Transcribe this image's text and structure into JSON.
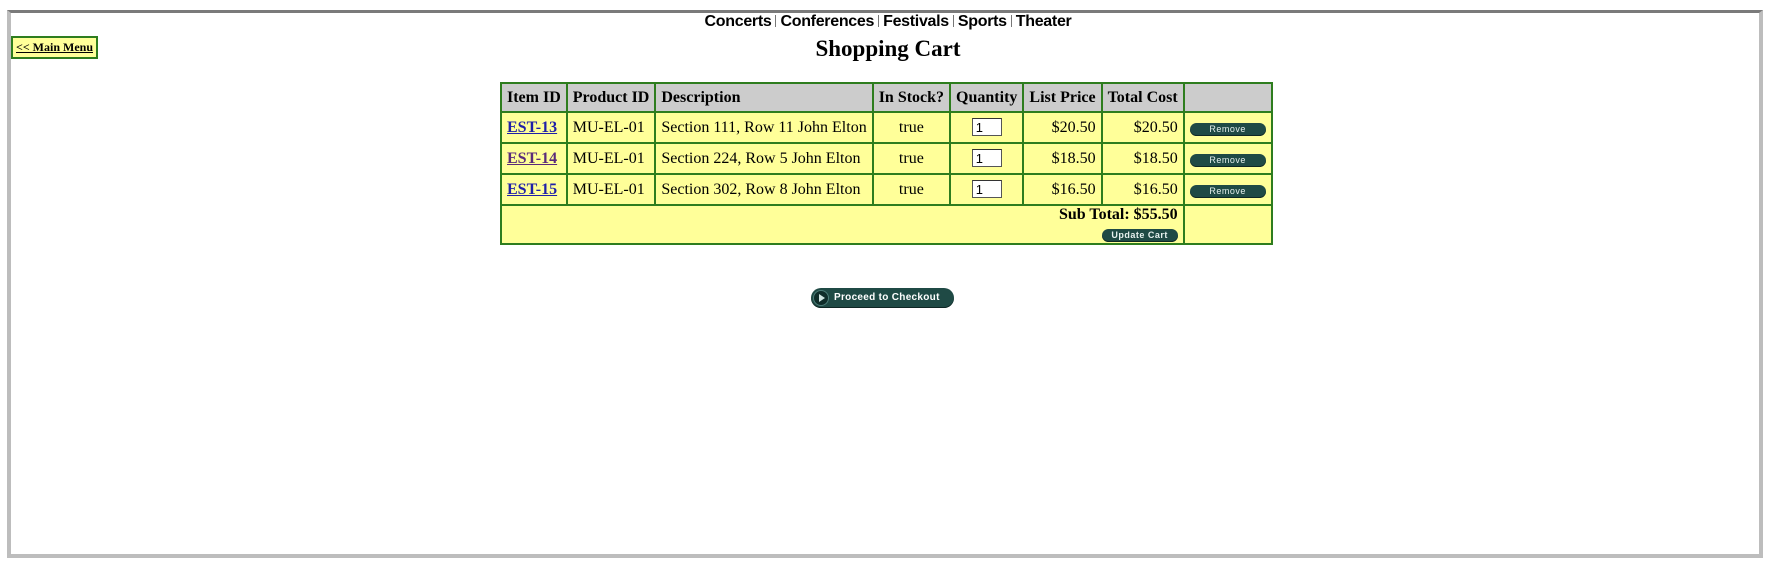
{
  "nav": {
    "items": [
      "Concerts",
      "Conferences",
      "Festivals",
      "Sports",
      "Theater"
    ]
  },
  "main_menu_label": "<< Main Menu",
  "page_title": "Shopping Cart",
  "table": {
    "headers": [
      "Item ID",
      "Product ID",
      "Description",
      "In Stock?",
      "Quantity",
      "List Price",
      "Total Cost",
      ""
    ],
    "rows": [
      {
        "item_id": "EST-13",
        "product_id": "MU-EL-01",
        "description": "Section 111, Row 11 John Elton",
        "in_stock": "true",
        "quantity": "1",
        "list_price": "$20.50",
        "total_cost": "$20.50",
        "remove_label": "Remove"
      },
      {
        "item_id": "EST-14",
        "product_id": "MU-EL-01",
        "description": "Section 224, Row 5 John Elton",
        "in_stock": "true",
        "quantity": "1",
        "list_price": "$18.50",
        "total_cost": "$18.50",
        "remove_label": "Remove"
      },
      {
        "item_id": "EST-15",
        "product_id": "MU-EL-01",
        "description": "Section 302, Row 8 John Elton",
        "in_stock": "true",
        "quantity": "1",
        "list_price": "$16.50",
        "total_cost": "$16.50",
        "remove_label": "Remove"
      }
    ],
    "subtotal": "Sub Total: $55.50",
    "update_label": "Update Cart"
  },
  "checkout_label": "Proceed to Checkout",
  "colors": {
    "table_bg": "#ffff99",
    "table_border": "#2e7d1e",
    "header_bg": "#cccccc",
    "button_bg": "#1f4a45"
  }
}
